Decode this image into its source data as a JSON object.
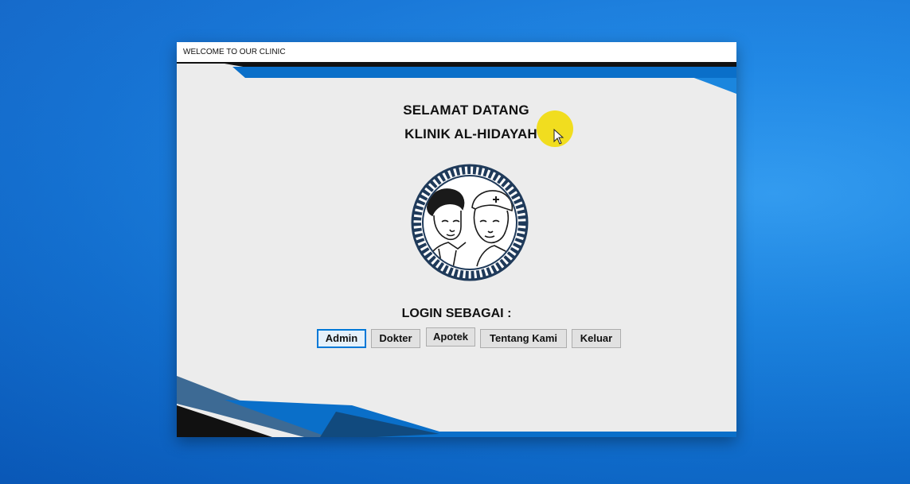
{
  "window": {
    "title": "WELCOME TO OUR CLINIC"
  },
  "header": {
    "line1": "SELAMAT DATANG",
    "line2": "KLINIK AL-HIDAYAH"
  },
  "logo": {
    "icon": "doctor-nurse-emblem-icon",
    "ring_color": "#1f3a5a"
  },
  "login": {
    "label": "LOGIN SEBAGAI :",
    "buttons": [
      {
        "label": "Admin"
      },
      {
        "label": "Dokter"
      },
      {
        "label": "Apotek"
      },
      {
        "label": "Tentang Kami"
      },
      {
        "label": "Keluar"
      }
    ]
  },
  "colors": {
    "accent_blue": "#0a6fc9",
    "dark_band": "#111111",
    "cursor_highlight": "#f1dc14",
    "focus_border": "#0078d7"
  }
}
